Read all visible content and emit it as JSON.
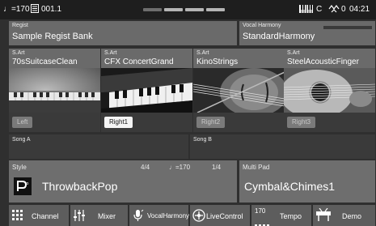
{
  "status": {
    "tempo": "♩=170",
    "measure": "001.1",
    "right_value_1": "C",
    "right_value_2": "0",
    "time": "04:21"
  },
  "regist": {
    "label": "Regist",
    "name": "Sample Regist Bank"
  },
  "vocal_harmony": {
    "label": "Vocal Harmony",
    "name": "StandardHarmony"
  },
  "voices": [
    {
      "tag": "S.Art",
      "name": "70sSuitcaseClean",
      "part": "Left",
      "active": false,
      "icon": "electric-piano-photo"
    },
    {
      "tag": "S.Art",
      "name": "CFX ConcertGrand",
      "part": "Right1",
      "active": true,
      "icon": "grand-piano-photo"
    },
    {
      "tag": "S.Art",
      "name": "KinoStrings",
      "part": "Right2",
      "active": false,
      "icon": "violin-photo"
    },
    {
      "tag": "S.Art",
      "name": "SteelAcousticFinger",
      "part": "Right3",
      "active": false,
      "icon": "acoustic-guitar-photo"
    }
  ],
  "song_a": {
    "label": "Song A"
  },
  "song_b": {
    "label": "Song B"
  },
  "style": {
    "label": "Style",
    "time_sig": "4/4",
    "tempo": "♩=170",
    "bar": "1/4",
    "name": "ThrowbackPop",
    "icon": "pro-style-icon"
  },
  "multipad": {
    "label": "Multi Pad",
    "name": "Cymbal&Chimes1"
  },
  "bottom": {
    "channel": "Channel",
    "mixer": "Mixer",
    "vocal_harmony": "VocalHarmony",
    "live_control": "LiveControl",
    "tempo_value": "170",
    "tempo": "Tempo",
    "demo": "Demo"
  },
  "colors": {
    "background": "#2f2f2f",
    "panel": "#6a6a6a",
    "active_part": "#f4f4f4"
  }
}
